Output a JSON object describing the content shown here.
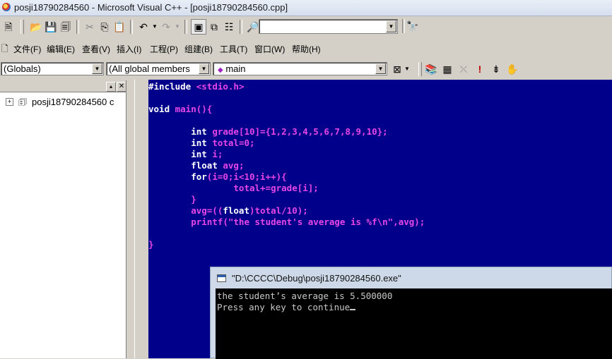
{
  "window": {
    "title": "posji18790284560 - Microsoft Visual C++ - [posji18790284560.cpp]"
  },
  "menu": [
    "文件(F)",
    "编辑(E)",
    "查看(V)",
    "插入(I)",
    "工程(P)",
    "组建(B)",
    "工具(T)",
    "窗口(W)",
    "帮助(H)"
  ],
  "wizardbar": {
    "scope": "(Globals)",
    "members": "(All global members",
    "function": "main"
  },
  "workspace": {
    "tree_item": "posji18790284560 c"
  },
  "code": {
    "l1_kw": "#include",
    "l1_rest": " <stdio.h>",
    "l3_kw": "void",
    "l3_rest": " main(){",
    "l5_indent": "        ",
    "l5_kw": "int",
    "l5_rest": " grade[10]={1,2,3,4,5,6,7,8,9,10};",
    "l6_kw": "int",
    "l6_rest": " total=0;",
    "l7_kw": "int",
    "l7_rest": " i;",
    "l8_kw": "float",
    "l8_rest": " avg;",
    "l9_kw": "for",
    "l9_rest": "(i=0;i<10;i++){",
    "l10": "                total+=grade[i];",
    "l11": "        }",
    "l12a": "        avg=((",
    "l12_kw": "float",
    "l12b": ")total/10);",
    "l13": "        printf(\"the student's average is %f\\n\",avg);",
    "l15": "}"
  },
  "console": {
    "title": "\"D:\\CCCC\\Debug\\posji18790284560.exe\"",
    "line1": "the student’s average is 5.500000",
    "line2": "Press any key to continue"
  }
}
